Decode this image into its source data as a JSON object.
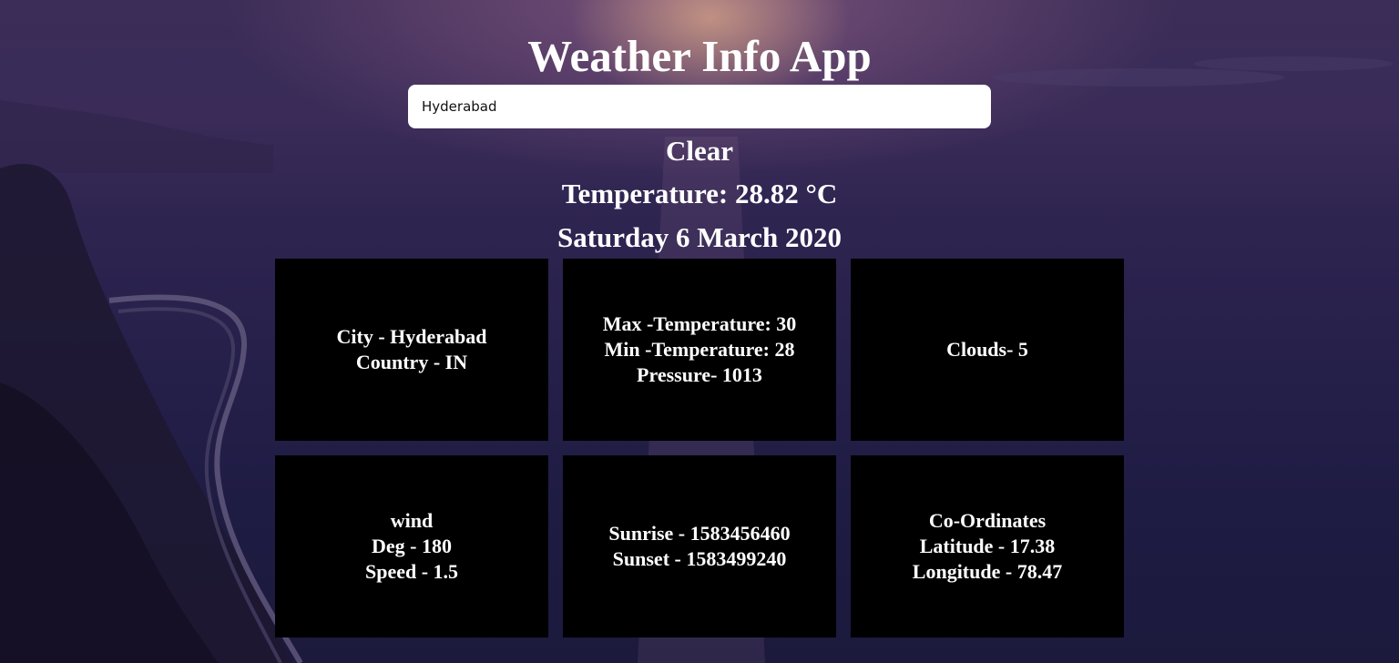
{
  "app": {
    "title": "Weather Info App"
  },
  "search": {
    "value": "Hyderabad",
    "placeholder": ""
  },
  "summary": {
    "condition": "Clear",
    "temperature": "Temperature: 28.82 °C",
    "date": "Saturday 6 March 2020"
  },
  "cards": {
    "location": {
      "city": "City - Hyderabad",
      "country": "Country - IN"
    },
    "temperature": {
      "max": "Max -Temperature: 30",
      "min": "Min -Temperature: 28",
      "pressure": "Pressure- 1013"
    },
    "clouds": {
      "value": "Clouds- 5"
    },
    "wind": {
      "heading": "wind",
      "deg": "Deg - 180",
      "speed": "Speed - 1.5"
    },
    "sun": {
      "sunrise": "Sunrise - 1583456460",
      "sunset": "Sunset - 1583499240"
    },
    "coordinates": {
      "heading": "Co-Ordinates",
      "latitude": "Latitude - 17.38",
      "longitude": "Longitude - 78.47"
    }
  },
  "colors": {
    "card_background": "#000000",
    "text": "#ffffff",
    "input_background": "#ffffff"
  }
}
